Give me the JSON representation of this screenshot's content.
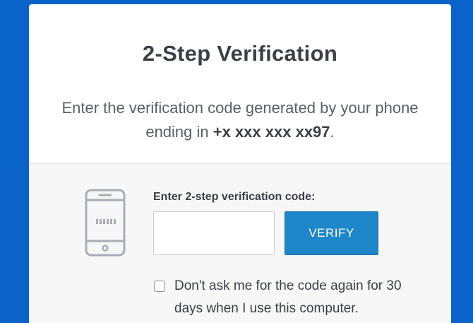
{
  "dialog": {
    "title": "2-Step Verification",
    "description_prefix": "Enter the verification code generated by your phone ending in ",
    "phone_masked": "+x xxx xxx xx97",
    "description_suffix": "."
  },
  "form": {
    "code_label": "Enter 2-step verification code:",
    "code_value": "",
    "verify_label": "VERIFY",
    "remember_checked": false,
    "remember_label": "Don't ask me for the code again for 30 days when I use this computer."
  },
  "icons": {
    "phone": "smartphone-icon"
  },
  "colors": {
    "background": "#0a63c9",
    "button": "#1f86c9",
    "text": "#3b3f47"
  }
}
